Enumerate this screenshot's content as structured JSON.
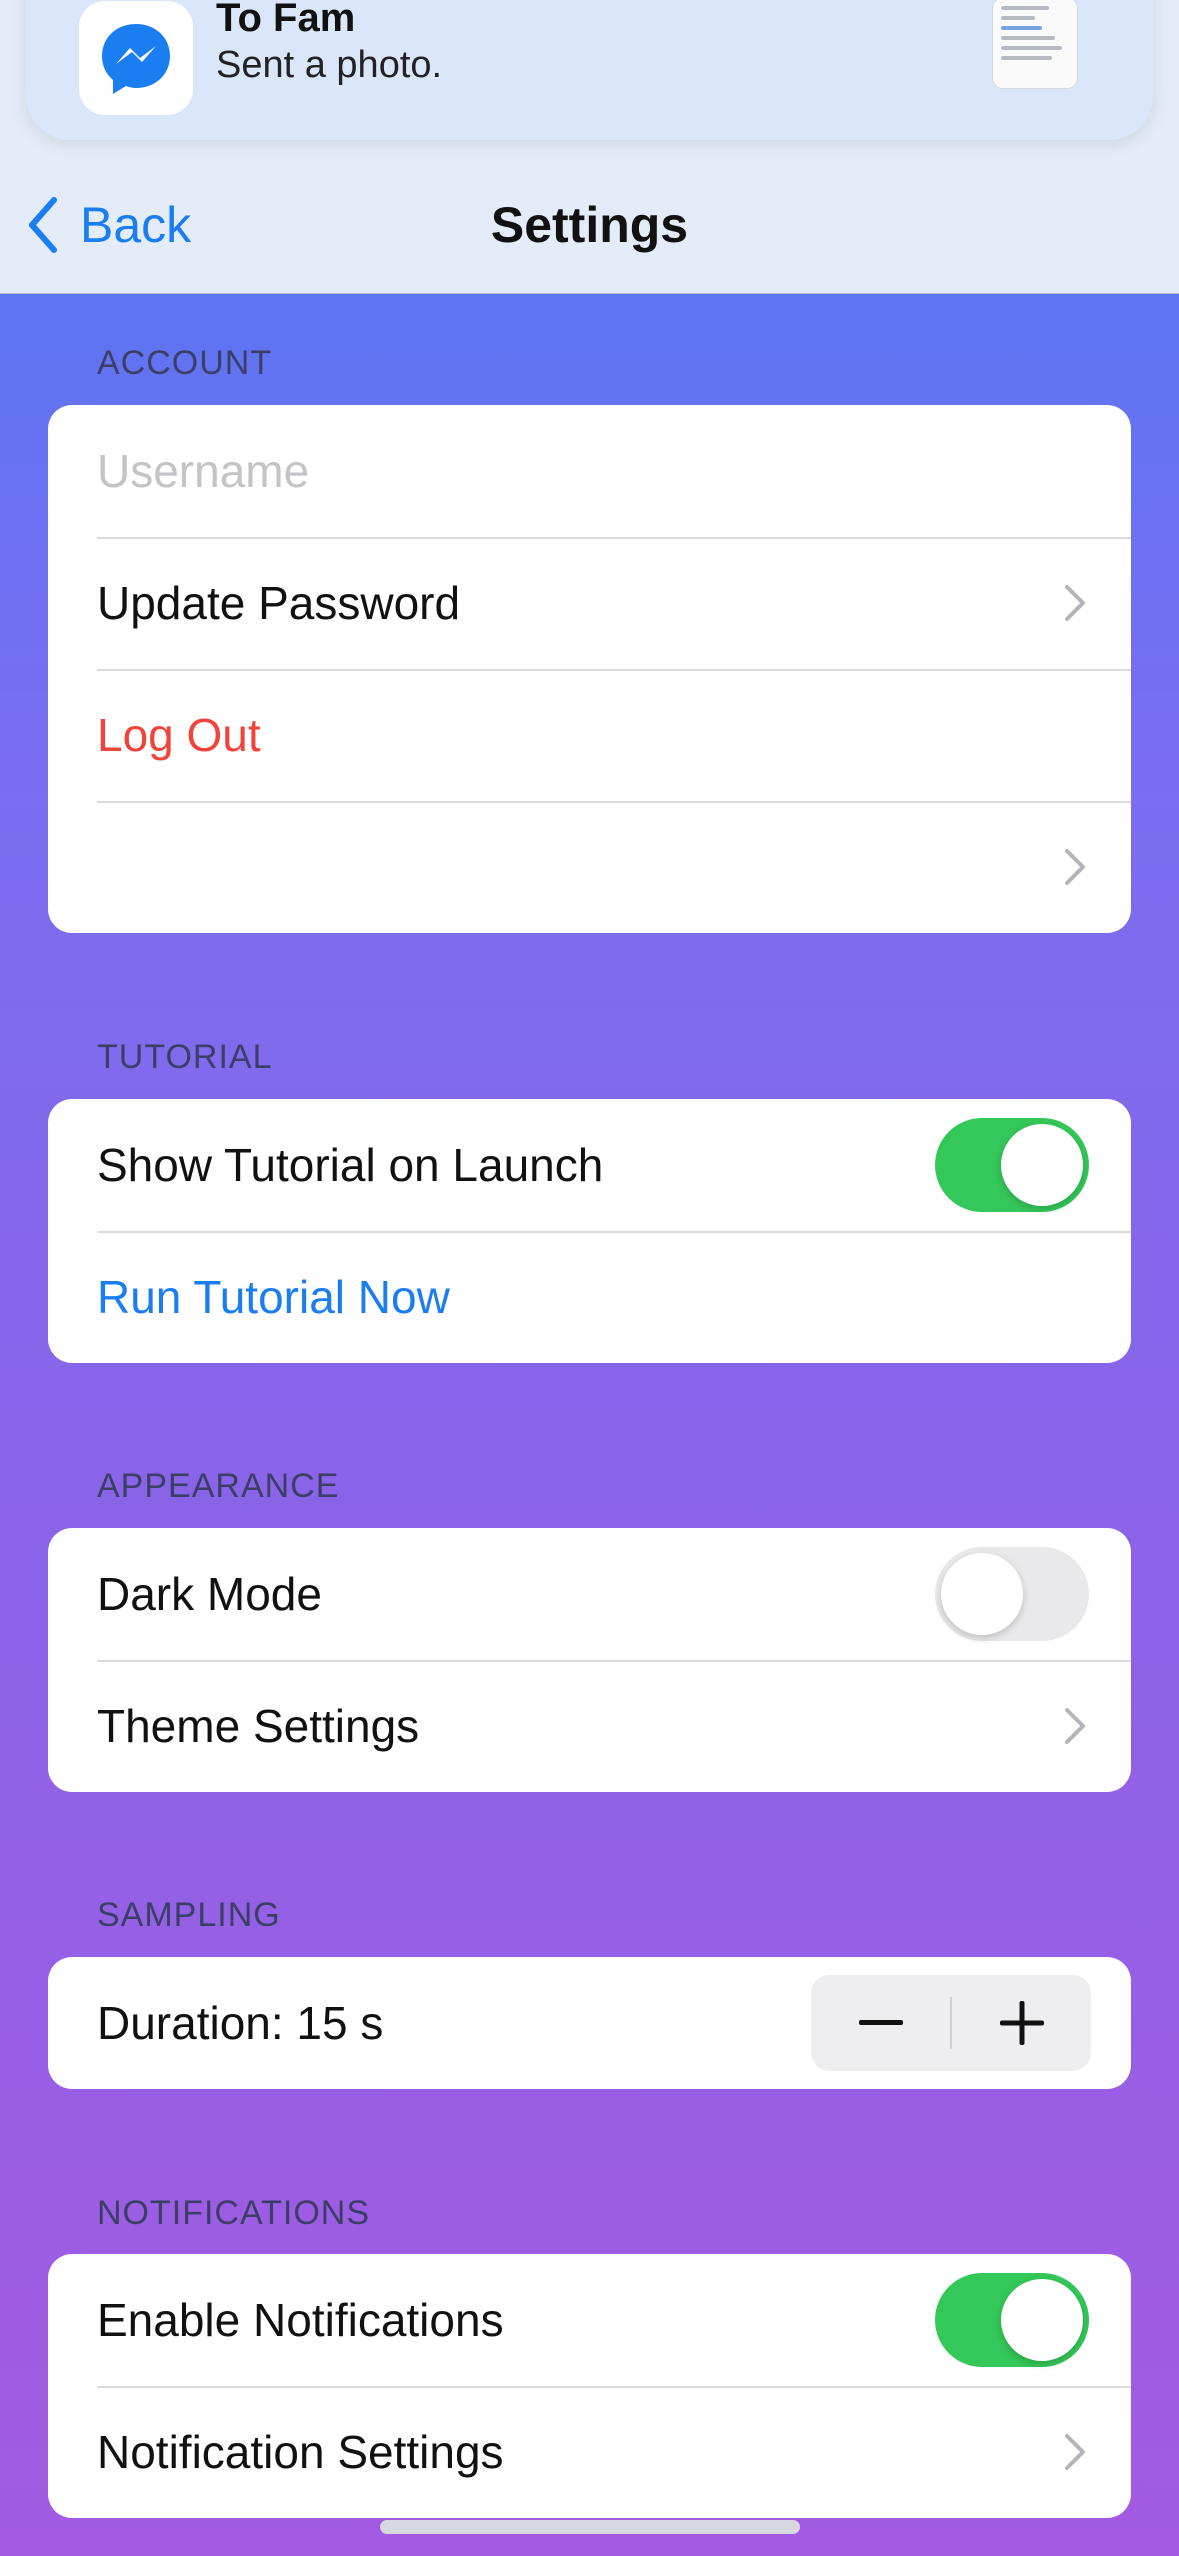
{
  "banner": {
    "title": "To Fam",
    "subtitle": "Sent a photo.",
    "app_icon": "messenger-icon"
  },
  "nav": {
    "back_label": "Back",
    "title": "Settings"
  },
  "sections": {
    "account": {
      "header": "ACCOUNT",
      "username_placeholder": "Username",
      "username_value": "",
      "update_password": "Update Password",
      "log_out": "Log Out",
      "empty_row_label": ""
    },
    "tutorial": {
      "header": "TUTORIAL",
      "show_on_launch": "Show Tutorial on Launch",
      "show_on_launch_enabled": true,
      "run_now": "Run Tutorial Now"
    },
    "appearance": {
      "header": "APPEARANCE",
      "dark_mode": "Dark Mode",
      "dark_mode_enabled": false,
      "theme_settings": "Theme Settings"
    },
    "sampling": {
      "header": "SAMPLING",
      "duration_label": "Duration: 15 s"
    },
    "notifications": {
      "header": "NOTIFICATIONS",
      "enable": "Enable Notifications",
      "enable_enabled": true,
      "settings": "Notification Settings"
    }
  },
  "colors": {
    "accent_blue": "#1a7df2",
    "destructive_red": "#f0433a",
    "toggle_on": "#34c759",
    "toggle_off": "#e9e9eb"
  }
}
